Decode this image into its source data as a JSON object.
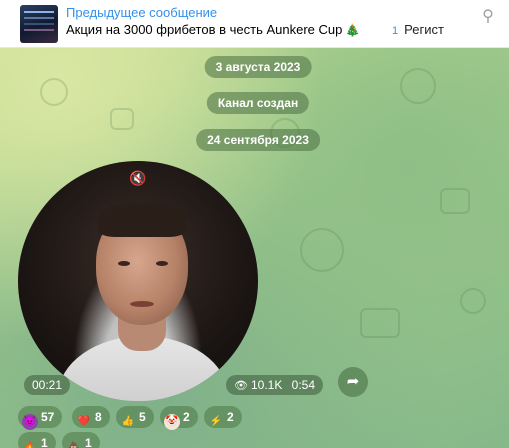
{
  "pinned": {
    "title": "Предыдущее сообщение",
    "text": "Акция на 3000 фрибетов в честь Aunkere Cup",
    "right_num": "1",
    "right_text": "Регист",
    "icons": {
      "tree": "christmas-tree-icon",
      "unpin": "unpin-icon"
    }
  },
  "service": {
    "date1": "3 августа 2023",
    "channel_created": "Канал создан",
    "date2": "24 сентября 2023"
  },
  "video": {
    "duration": "00:21",
    "views": "10.1K",
    "time": "0:54",
    "muted": true
  },
  "reactions": [
    {
      "emoji": "smiling-devil",
      "count": "57",
      "color": "#8e44ad"
    },
    {
      "emoji": "red-heart",
      "count": "8",
      "color": "#e53935"
    },
    {
      "emoji": "thumbs-up",
      "count": "5",
      "color": "#f2b233"
    },
    {
      "emoji": "clown-face",
      "count": "2",
      "color": "#f5e6d3"
    },
    {
      "emoji": "high-voltage",
      "count": "2",
      "color": "#f5c518"
    },
    {
      "emoji": "fire",
      "count": "1",
      "color": "#ff7a1a"
    },
    {
      "emoji": "pile-of-poo",
      "count": "1",
      "color": "#8d5a3b"
    }
  ]
}
